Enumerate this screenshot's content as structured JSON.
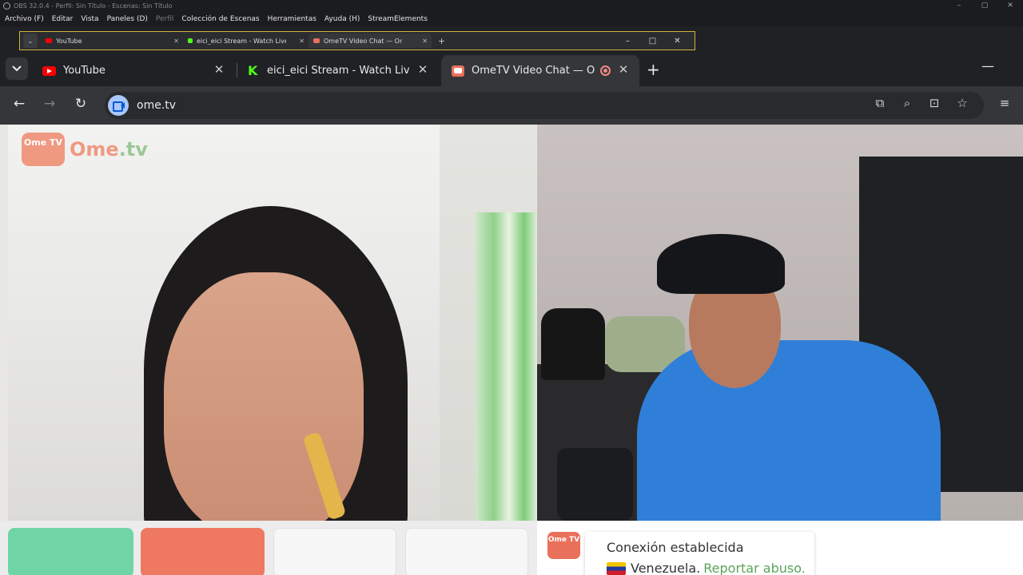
{
  "obs": {
    "title": "OBS 32.0.4 - Perfil: Sin Título - Escenas: Sin Título",
    "menu": [
      "Archivo (F)",
      "Editar",
      "Vista",
      "Paneles (D)",
      "Perfil",
      "Colección de Escenas",
      "Herramientas",
      "Ayuda (H)",
      "StreamElements"
    ],
    "window_controls": [
      "–",
      "▢",
      "✕"
    ]
  },
  "mini_browser": {
    "tabs": [
      {
        "label": "YouTube"
      },
      {
        "label": "eici_eici Stream - Watch Live on"
      },
      {
        "label": "OmeTV Video Chat — Ome"
      }
    ],
    "plus": "+",
    "controls": [
      "–",
      "□",
      "✕"
    ]
  },
  "browser": {
    "tabs": [
      {
        "label": "YouTube",
        "icon": "youtube-icon"
      },
      {
        "label": "eici_eici Stream - Watch Live on",
        "icon": "kick-icon"
      },
      {
        "label": "OmeTV Video Chat — Ome",
        "icon": "ometv-icon",
        "recording": true
      }
    ],
    "close": "✕",
    "new_tab": "+",
    "minimize": "—",
    "url": "ome.tv",
    "colors": {
      "tab_active": "#35363a",
      "tab_bar": "#202124",
      "omnibox": "#282a2d"
    }
  },
  "ometv": {
    "logo_badge": "Ome TV",
    "logo_word": "Ome",
    "logo_tld": ".tv",
    "chat": {
      "avatar_text": "Ome TV",
      "status": "Conexión establecida",
      "country": "Venezuela.",
      "report_link": "Reportar abuso."
    },
    "colors": {
      "start": "#6fd4a6",
      "stop": "#ee7960",
      "brand": "#e9705a",
      "link": "#5aa35a"
    }
  }
}
